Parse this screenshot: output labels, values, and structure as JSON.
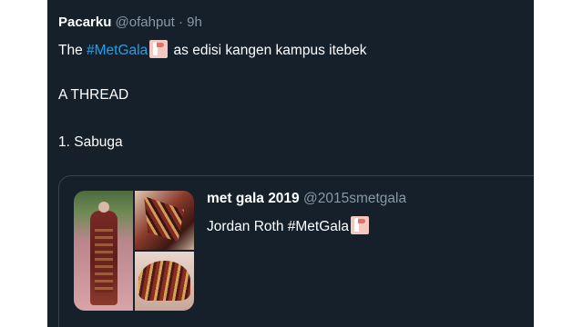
{
  "tweet": {
    "author_name": "Pacarku",
    "author_handle": "@ofahput",
    "separator": "·",
    "time": "9h",
    "text_prefix": "The ",
    "hashtag": "#MetGala",
    "text_suffix": " as edisi kangen kampus itebek",
    "line_thread": "A THREAD",
    "line_item": "1. Sabuga"
  },
  "quoted_tweet": {
    "author_name": "met gala 2019",
    "author_handle": "@2015smetgala",
    "text_prefix": "Jordan Roth ",
    "hashtag": "#MetGala",
    "media": [
      "gown-photo",
      "gown-detail-photo",
      "gown-back-photo"
    ]
  },
  "icons": {
    "hashtag_emoji": "flamingo-hashflag-icon"
  },
  "colors": {
    "background": "#15202b",
    "text": "#ffffff",
    "muted": "#8899a6",
    "link": "#1da1f2",
    "border": "#38444d"
  }
}
